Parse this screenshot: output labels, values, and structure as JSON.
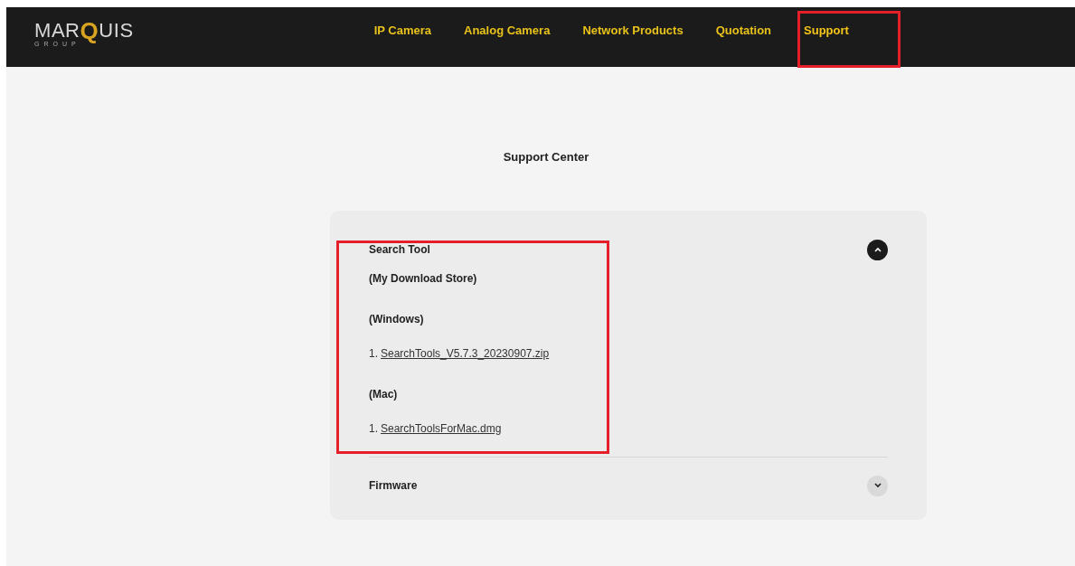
{
  "logo": {
    "before": "MAR",
    "q": "Q",
    "after": "UIS",
    "sub": "GROUP"
  },
  "nav": [
    {
      "label": "IP Camera",
      "selected": false
    },
    {
      "label": "Analog Camera",
      "selected": false
    },
    {
      "label": "Network Products",
      "selected": false
    },
    {
      "label": "Quotation",
      "selected": false
    },
    {
      "label": "Support",
      "selected": true
    }
  ],
  "title": "Support Center",
  "accordion": [
    {
      "title": "Search Tool",
      "expanded": true,
      "content": [
        {
          "kind": "heading",
          "text": "(My Download Store)"
        },
        {
          "kind": "heading",
          "text": "(Windows)"
        },
        {
          "kind": "link",
          "number": "1.",
          "text": "SearchTools_V5.7.3_20230907.zip"
        },
        {
          "kind": "heading",
          "text": "(Mac)"
        },
        {
          "kind": "link",
          "number": "1.",
          "text": "SearchToolsForMac.dmg"
        }
      ]
    },
    {
      "title": "Firmware",
      "expanded": false
    }
  ]
}
